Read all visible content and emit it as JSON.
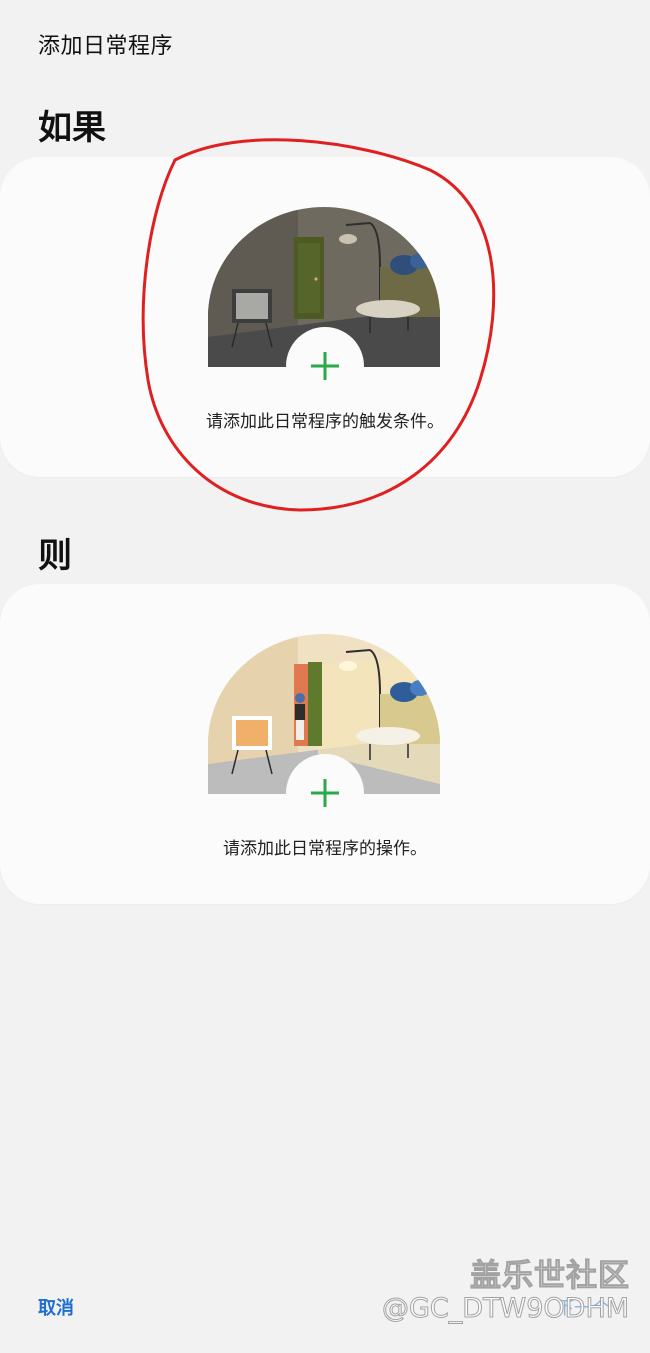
{
  "header": {
    "title": "添加日常程序"
  },
  "if_section": {
    "heading": "如果",
    "prompt": "请添加此日常程序的触发条件。",
    "add_icon": "plus-icon"
  },
  "then_section": {
    "heading": "则",
    "prompt": "请添加此日常程序的操作。",
    "add_icon": "plus-icon"
  },
  "footer": {
    "cancel_label": "取消",
    "next_label": "下一个"
  },
  "watermark": {
    "logo_text": "盖乐世社区",
    "user_id": "@GC_DTW9ODHM"
  },
  "colors": {
    "accent_blue": "#1d6fd1",
    "plus_green": "#2aa84a",
    "annotation_red": "#e02020",
    "background": "#f2f2f2",
    "card": "#fbfbfb"
  }
}
